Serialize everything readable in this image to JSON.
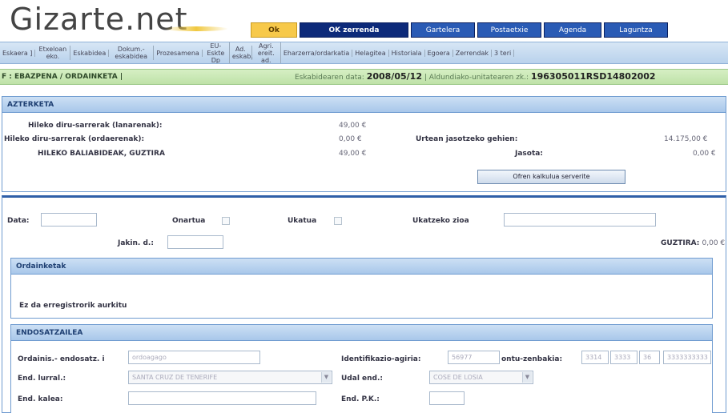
{
  "header": {
    "logo": "Gizarte.net",
    "nav": [
      "Ok",
      "OK zerrenda",
      "Gartelera",
      "Postaetxie",
      "Agenda",
      "Laguntza"
    ]
  },
  "subnav": [
    "Eskaera ]",
    "Etxeloan eko.",
    "Eskabidea",
    "Dokum.- eskabidea",
    "Prozesamena",
    "EU-Eskte Dp",
    "Ad. eskab.",
    "Agri. ereit. ad.",
    "Eharzerra/ordarkatia",
    "Helagitea",
    "Historiala",
    "Egoera",
    "Zerrendak",
    "3 teri"
  ],
  "status": {
    "left": "F : EBAZPENA / ORDAINKETA |",
    "date_label": "Eskabidearen data:",
    "date_value": "2008/05/12",
    "id_label": "| Aldundiako-unitatearen zk.:",
    "id_value": "196305011RSD14802002"
  },
  "summary": {
    "title": "AZTERKETA",
    "row1_label": "Hileko diru-sarrerak (lanarenak):",
    "row1_value": "49,00 €",
    "row2_label": "Hileko diru-sarrerak (ordaerenak):",
    "row2_value": "0,00 €",
    "row3_label": "HILEKO BALIABIDEAK, GUZTIRA",
    "row3_value": "49,00 €",
    "r_row1_label": "Urtean jasotzeko gehien:",
    "r_row1_value": "14.175,00 €",
    "r_row2_label": "Jasota:",
    "r_row2_value": "0,00 €",
    "button": "Ofren kalkulua serverite"
  },
  "form": {
    "date_label": "Data:",
    "date_value": "",
    "approved_label": "Onartua",
    "rejected_label": "Ukatua",
    "reject_reason_label": "Ukatzeko zioa",
    "reject_reason_value": "",
    "jakin_label": "Jakin. d.:",
    "jakin_value": "",
    "total_label": "GUZTIRA:",
    "total_value": "0,00 €",
    "payments_title": "Ordainketak",
    "payments_empty": "Ez da erregistrorik aurkitu",
    "endorser_title": "ENDOSATZAILEA",
    "endorser_name_label": "Ordainis.- endosatz. i",
    "endorser_name_value": "ordoagago",
    "id_doc_label": "Identifikazio-agiria:",
    "id_doc_value": "56977",
    "account_label": "ontu-zenbakia:",
    "account_parts": [
      "3314",
      "3333",
      "36",
      "3333333333"
    ],
    "province_label": "End. lurral.:",
    "province_value": "SANTA CRUZ DE TENERIFE",
    "town_label": "Udal end.:",
    "town_value": "COSE DE LOSIA",
    "street_label": "End. kalea:",
    "street_value": "",
    "postal_label": "End. P.K.:",
    "postal_value": ""
  }
}
